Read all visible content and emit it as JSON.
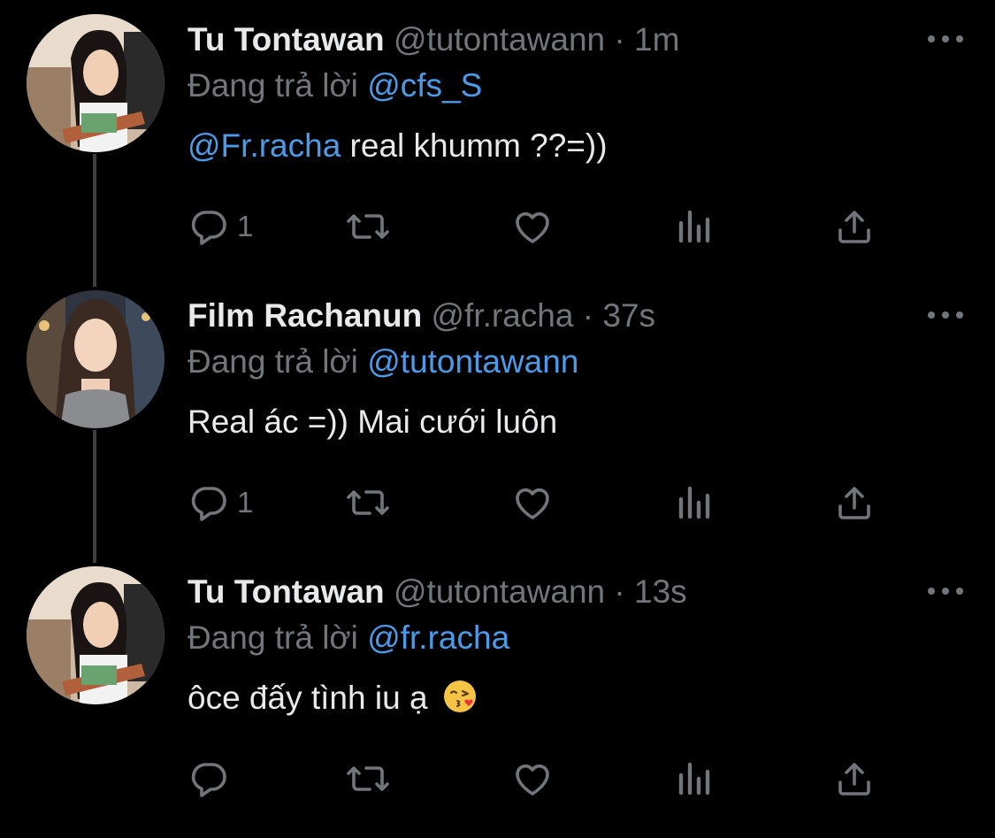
{
  "colors": {
    "background": "#000000",
    "primary_text": "#e7e9ea",
    "secondary_text": "#71767b",
    "link": "#4c9be8",
    "thread_line": "#3e4144"
  },
  "tweets": [
    {
      "name": "Tu Tontawan",
      "handle": "@tutontawann",
      "dot": "·",
      "time": "1m",
      "reply_prefix": "Đang trả lời",
      "reply_to": "@cfs_S",
      "body_mention": "@Fr.racha",
      "body_text": " real khumm ??=))",
      "reply_count": "1",
      "avatar": "avatar-tu-tontawan"
    },
    {
      "name": "Film Rachanun",
      "handle": "@fr.racha",
      "dot": "·",
      "time": "37s",
      "reply_prefix": "Đang trả lời",
      "reply_to": "@tutontawann",
      "body_mention": "",
      "body_text": "Real ác =)) Mai cưới luôn",
      "reply_count": "1",
      "avatar": "avatar-film-rachanun"
    },
    {
      "name": "Tu Tontawan",
      "handle": "@tutontawann",
      "dot": "·",
      "time": "13s",
      "reply_prefix": "Đang trả lời",
      "reply_to": "@fr.racha",
      "body_mention": "",
      "body_text": "ôce đấy tình iu ạ",
      "body_emoji": "kissing-face-with-heart-emoji",
      "reply_count": "",
      "avatar": "avatar-tu-tontawan"
    }
  ],
  "icons": {
    "reply": "reply-icon",
    "retweet": "retweet-icon",
    "like": "like-icon",
    "views": "views-icon",
    "share": "share-icon",
    "more": "more-icon"
  }
}
